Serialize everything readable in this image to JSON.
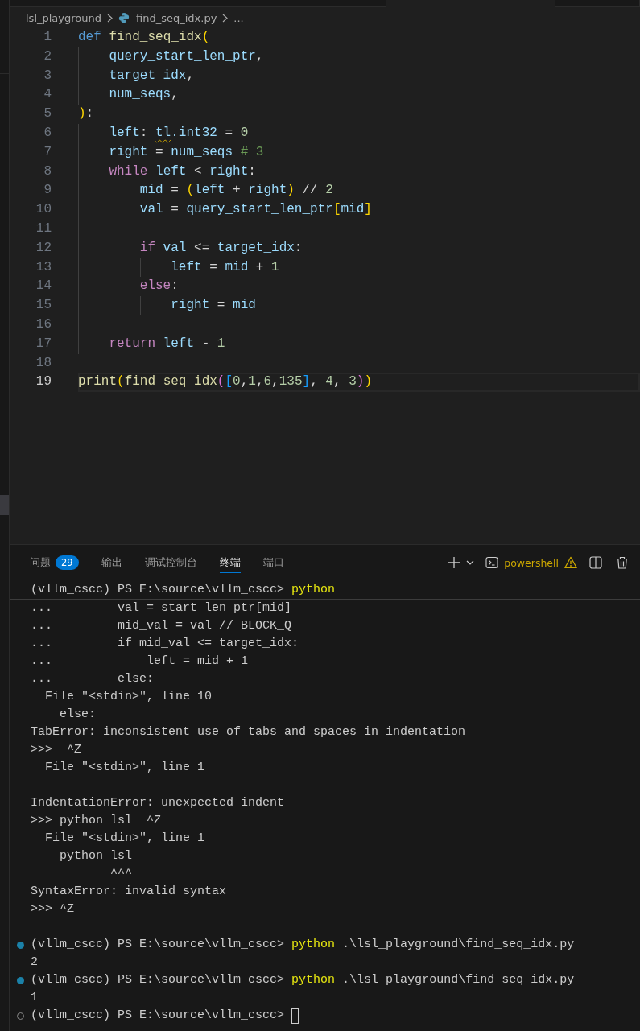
{
  "editor_tabs": [
    {
      "selected": false
    },
    {
      "selected": false
    },
    {
      "selected": true
    },
    {
      "selected": false
    }
  ],
  "breadcrumb": [
    {
      "label": "lsl_playground",
      "kind": "folder"
    },
    {
      "label": "find_seq_idx.py",
      "kind": "python_file"
    },
    {
      "label": "...",
      "kind": "more"
    }
  ],
  "editor": {
    "lines": [
      {
        "number": "1",
        "current": false,
        "tokens": [
          {
            "text": "def",
            "kind": "storage"
          },
          {
            "text": " find_seq_idx",
            "kind": "function"
          },
          {
            "text": "(",
            "kind": "bracket1"
          }
        ]
      },
      {
        "number": "2",
        "current": false,
        "tokens": [
          {
            "text": "    query_start_len_ptr",
            "kind": "variable"
          },
          {
            "text": ",",
            "kind": "plain"
          }
        ]
      },
      {
        "number": "3",
        "current": false,
        "tokens": [
          {
            "text": "    target_idx",
            "kind": "variable"
          },
          {
            "text": ",",
            "kind": "plain"
          }
        ]
      },
      {
        "number": "4",
        "current": false,
        "tokens": [
          {
            "text": "    num_seqs",
            "kind": "variable"
          },
          {
            "text": ",",
            "kind": "plain"
          }
        ]
      },
      {
        "number": "5",
        "current": false,
        "tokens": [
          {
            "text": ")",
            "kind": "bracket1"
          },
          {
            "text": ":",
            "kind": "plain"
          }
        ]
      },
      {
        "number": "6",
        "current": false,
        "tokens": [
          {
            "text": "    left",
            "kind": "variable"
          },
          {
            "text": ": ",
            "kind": "plain"
          },
          {
            "text": "tl",
            "kind": "unresolved"
          },
          {
            "text": ".int32",
            "kind": "variable"
          },
          {
            "text": " = ",
            "kind": "plain"
          },
          {
            "text": "0",
            "kind": "number"
          }
        ]
      },
      {
        "number": "7",
        "current": false,
        "tokens": [
          {
            "text": "    right",
            "kind": "variable"
          },
          {
            "text": " = ",
            "kind": "plain"
          },
          {
            "text": "num_seqs",
            "kind": "variable"
          },
          {
            "text": " # 3",
            "kind": "comment"
          }
        ]
      },
      {
        "number": "8",
        "current": false,
        "tokens": [
          {
            "text": "    while",
            "kind": "control"
          },
          {
            "text": " left",
            "kind": "variable"
          },
          {
            "text": " < ",
            "kind": "plain"
          },
          {
            "text": "right",
            "kind": "variable"
          },
          {
            "text": ":",
            "kind": "plain"
          }
        ]
      },
      {
        "number": "9",
        "current": false,
        "tokens": [
          {
            "text": "        mid",
            "kind": "variable"
          },
          {
            "text": " = ",
            "kind": "plain"
          },
          {
            "text": "(",
            "kind": "bracket1"
          },
          {
            "text": "left",
            "kind": "variable"
          },
          {
            "text": " + ",
            "kind": "plain"
          },
          {
            "text": "right",
            "kind": "variable"
          },
          {
            "text": ")",
            "kind": "bracket1"
          },
          {
            "text": " // ",
            "kind": "plain"
          },
          {
            "text": "2",
            "kind": "number"
          }
        ]
      },
      {
        "number": "10",
        "current": false,
        "tokens": [
          {
            "text": "        val",
            "kind": "variable"
          },
          {
            "text": " = ",
            "kind": "plain"
          },
          {
            "text": "query_start_len_ptr",
            "kind": "variable"
          },
          {
            "text": "[",
            "kind": "bracket1"
          },
          {
            "text": "mid",
            "kind": "variable"
          },
          {
            "text": "]",
            "kind": "bracket1"
          }
        ]
      },
      {
        "number": "11",
        "current": false
      },
      {
        "number": "12",
        "current": false,
        "tokens": [
          {
            "text": "        if",
            "kind": "control"
          },
          {
            "text": " val",
            "kind": "variable"
          },
          {
            "text": " <= ",
            "kind": "plain"
          },
          {
            "text": "target_idx",
            "kind": "variable"
          },
          {
            "text": ":",
            "kind": "plain"
          }
        ]
      },
      {
        "number": "13",
        "current": false,
        "tokens": [
          {
            "text": "            left",
            "kind": "variable"
          },
          {
            "text": " = ",
            "kind": "plain"
          },
          {
            "text": "mid",
            "kind": "variable"
          },
          {
            "text": " + ",
            "kind": "plain"
          },
          {
            "text": "1",
            "kind": "number"
          }
        ]
      },
      {
        "number": "14",
        "current": false,
        "tokens": [
          {
            "text": "        else",
            "kind": "control"
          },
          {
            "text": ":",
            "kind": "plain"
          }
        ]
      },
      {
        "number": "15",
        "current": false,
        "tokens": [
          {
            "text": "            right",
            "kind": "variable"
          },
          {
            "text": " = ",
            "kind": "plain"
          },
          {
            "text": "mid",
            "kind": "variable"
          }
        ]
      },
      {
        "number": "16",
        "current": false
      },
      {
        "number": "17",
        "current": false,
        "tokens": [
          {
            "text": "    return",
            "kind": "control"
          },
          {
            "text": " left",
            "kind": "variable"
          },
          {
            "text": " - ",
            "kind": "plain"
          },
          {
            "text": "1",
            "kind": "number"
          }
        ]
      },
      {
        "number": "18",
        "current": false
      },
      {
        "number": "19",
        "current": true,
        "tokens": [
          {
            "text": "print",
            "kind": "function"
          },
          {
            "text": "(",
            "kind": "bracket1"
          },
          {
            "text": "find_seq_idx",
            "kind": "function"
          },
          {
            "text": "(",
            "kind": "bracket2"
          },
          {
            "text": "[",
            "kind": "bracket3"
          },
          {
            "text": "0",
            "kind": "number"
          },
          {
            "text": ",",
            "kind": "plain"
          },
          {
            "text": "1",
            "kind": "number"
          },
          {
            "text": ",",
            "kind": "plain"
          },
          {
            "text": "6",
            "kind": "number"
          },
          {
            "text": ",",
            "kind": "plain"
          },
          {
            "text": "135",
            "kind": "number"
          },
          {
            "text": "]",
            "kind": "bracket3"
          },
          {
            "text": ", ",
            "kind": "plain"
          },
          {
            "text": "4",
            "kind": "number"
          },
          {
            "text": ", ",
            "kind": "plain"
          },
          {
            "text": "3",
            "kind": "number"
          },
          {
            "text": ")",
            "kind": "bracket2"
          },
          {
            "text": ")",
            "kind": "bracket1"
          }
        ]
      }
    ]
  },
  "panel": {
    "tabs": [
      {
        "label": "问题",
        "badge": "29",
        "selected": false
      },
      {
        "label": "输出",
        "selected": false
      },
      {
        "label": "调试控制台",
        "selected": false
      },
      {
        "label": "终端",
        "selected": true
      },
      {
        "label": "端口",
        "selected": false
      }
    ],
    "terminal_tab": {
      "name": "powershell",
      "warning": true
    },
    "sticky_command": {
      "prompt": "(vllm_cscc) PS E:\\source\\vllm_cscc>",
      "command": "python"
    },
    "lines": [
      {
        "kind": "output",
        "text": "...         val = start_len_ptr[mid]"
      },
      {
        "kind": "output",
        "text": "...         mid_val = val // BLOCK_Q"
      },
      {
        "kind": "output",
        "text": "...         if mid_val <= target_idx:"
      },
      {
        "kind": "output",
        "text": "...             left = mid + 1"
      },
      {
        "kind": "output",
        "text": "...         else:"
      },
      {
        "kind": "output",
        "text": "  File \"<stdin>\", line 10"
      },
      {
        "kind": "output",
        "text": "    else:"
      },
      {
        "kind": "output",
        "text": "TabError: inconsistent use of tabs and spaces in indentation"
      },
      {
        "kind": "output",
        "text": ">>>  ^Z"
      },
      {
        "kind": "output",
        "text": "  File \"<stdin>\", line 1"
      },
      {
        "kind": "blank"
      },
      {
        "kind": "output",
        "text": "IndentationError: unexpected indent"
      },
      {
        "kind": "output",
        "text": ">>> python lsl  ^Z"
      },
      {
        "kind": "output",
        "text": "  File \"<stdin>\", line 1"
      },
      {
        "kind": "output",
        "text": "    python lsl"
      },
      {
        "kind": "output",
        "text": "           ^^^"
      },
      {
        "kind": "output",
        "text": "SyntaxError: invalid syntax"
      },
      {
        "kind": "output",
        "text": ">>> ^Z"
      },
      {
        "kind": "blank"
      },
      {
        "kind": "prompt",
        "finished": true,
        "prompt": "(vllm_cscc) PS E:\\source\\vllm_cscc>",
        "command": "python",
        "args": ".\\lsl_playground\\find_seq_idx.py",
        "cursor": false
      },
      {
        "kind": "output",
        "text": "2"
      },
      {
        "kind": "prompt",
        "finished": true,
        "prompt": "(vllm_cscc) PS E:\\source\\vllm_cscc>",
        "command": "python",
        "args": ".\\lsl_playground\\find_seq_idx.py",
        "cursor": false
      },
      {
        "kind": "output",
        "text": "1"
      },
      {
        "kind": "prompt",
        "finished": false,
        "prompt": "(vllm_cscc) PS E:\\source\\vllm_cscc>",
        "cursor": true
      }
    ]
  }
}
